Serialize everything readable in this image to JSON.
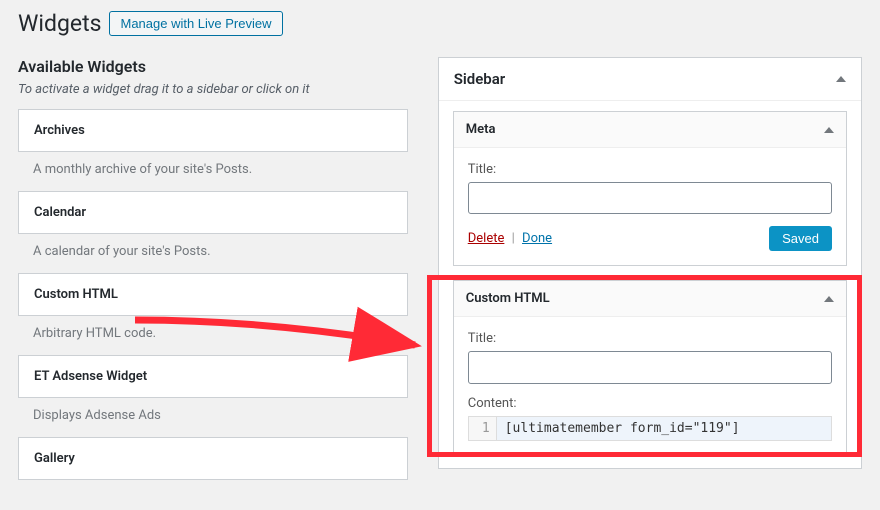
{
  "header": {
    "title": "Widgets",
    "live_preview_label": "Manage with Live Preview"
  },
  "left": {
    "section_title": "Available Widgets",
    "help_text": "To activate a widget drag it to a sidebar or click on it",
    "widgets": [
      {
        "name": "Archives",
        "desc": "A monthly archive of your site's Posts."
      },
      {
        "name": "Calendar",
        "desc": "A calendar of your site's Posts."
      },
      {
        "name": "Custom HTML",
        "desc": "Arbitrary HTML code."
      },
      {
        "name": "ET Adsense Widget",
        "desc": "Displays Adsense Ads"
      },
      {
        "name": "Gallery",
        "desc": ""
      }
    ]
  },
  "sidebar": {
    "area_title": "Sidebar",
    "meta": {
      "widget_name": "Meta",
      "title_label": "Title:",
      "title_value": "",
      "delete_label": "Delete",
      "done_label": "Done",
      "saved_label": "Saved"
    },
    "custom_html": {
      "widget_name": "Custom HTML",
      "title_label": "Title:",
      "title_value": "",
      "content_label": "Content:",
      "line_number": "1",
      "content_value": "[ultimatemember form_id=\"119\"]"
    }
  }
}
